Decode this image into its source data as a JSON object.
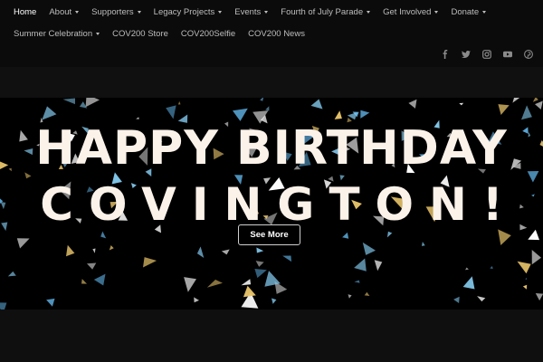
{
  "nav": {
    "row1": [
      {
        "label": "Home",
        "active": true,
        "dropdown": false
      },
      {
        "label": "About",
        "active": false,
        "dropdown": true
      },
      {
        "label": "Supporters",
        "active": false,
        "dropdown": true
      },
      {
        "label": "Legacy Projects",
        "active": false,
        "dropdown": true
      },
      {
        "label": "Events",
        "active": false,
        "dropdown": true
      },
      {
        "label": "Fourth of July Parade",
        "active": false,
        "dropdown": true
      },
      {
        "label": "Get Involved",
        "active": false,
        "dropdown": true
      },
      {
        "label": "Donate",
        "active": false,
        "dropdown": true
      }
    ],
    "row2": [
      {
        "label": "Summer Celebration",
        "active": false,
        "dropdown": true
      },
      {
        "label": "COV200 Store",
        "active": false,
        "dropdown": false
      },
      {
        "label": "COV200Selfie",
        "active": false,
        "dropdown": false
      },
      {
        "label": "COV200 News",
        "active": false,
        "dropdown": false
      }
    ]
  },
  "social": [
    "facebook-icon",
    "twitter-icon",
    "instagram-icon",
    "youtube-icon",
    "pinterest-icon"
  ],
  "hero": {
    "line1": "HAPPY BIRTHDAY",
    "line2": "COVINGTON!",
    "button_label": "See More"
  },
  "colors": {
    "background": "#0f0f0f",
    "hero_text": "#fbf2ea",
    "confetti": [
      "#7fc3e6",
      "#e8c46a",
      "#c9c9c9",
      "#ffffff",
      "#5aa6d6"
    ]
  }
}
